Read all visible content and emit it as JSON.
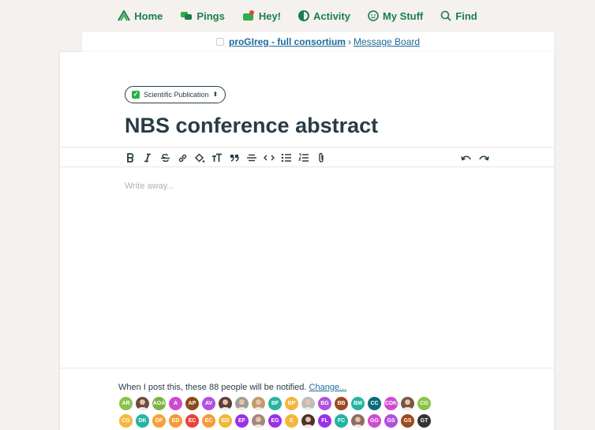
{
  "nav": {
    "home": "Home",
    "pings": "Pings",
    "hey": "Hey!",
    "activity": "Activity",
    "mystuff": "My Stuff",
    "find": "Find"
  },
  "breadcrumb": {
    "project": "proGIreg - full consortium",
    "separator": "›",
    "board": "Message Board"
  },
  "message": {
    "category": "Scientific Publication",
    "title": "NBS conference abstract",
    "placeholder": "Write away..."
  },
  "notify": {
    "text": "When I post this, these 88 people will be notified.",
    "change": "Change..."
  },
  "avatars": {
    "row1": [
      {
        "initials": "AR",
        "color": "#8bc34a"
      },
      {
        "initials": "",
        "color": "#6d4c41",
        "photo": true
      },
      {
        "initials": "AOA",
        "color": "#7cb342"
      },
      {
        "initials": "A",
        "color": "#d04ad0"
      },
      {
        "initials": "AP",
        "color": "#8d4a1d"
      },
      {
        "initials": "AV",
        "color": "#b150e0"
      },
      {
        "initials": "",
        "color": "#5d4037",
        "photo": true
      },
      {
        "initials": "",
        "color": "#9e9e9e",
        "photo": true
      },
      {
        "initials": "",
        "color": "#c49a6c",
        "photo": true
      },
      {
        "initials": "BF",
        "color": "#26b3a2"
      },
      {
        "initials": "BP",
        "color": "#f5b63a"
      },
      {
        "initials": "",
        "color": "#bdbdbd",
        "photo": true
      },
      {
        "initials": "BG",
        "color": "#b150e0"
      },
      {
        "initials": "BB",
        "color": "#9c4a1e"
      },
      {
        "initials": "BM",
        "color": "#26b3a2"
      },
      {
        "initials": "CC",
        "color": "#0a6b78"
      },
      {
        "initials": "CDK",
        "color": "#d04ad0"
      },
      {
        "initials": "",
        "color": "#795548",
        "photo": true
      },
      {
        "initials": "CG",
        "color": "#8bc34a"
      }
    ],
    "row2": [
      {
        "initials": "CG",
        "color": "#f5b63a"
      },
      {
        "initials": "DK",
        "color": "#26b3a2"
      },
      {
        "initials": "DF",
        "color": "#f5a03a"
      },
      {
        "initials": "ED",
        "color": "#f59a3a"
      },
      {
        "initials": "EC",
        "color": "#e8433a"
      },
      {
        "initials": "EC",
        "color": "#f59a3a"
      },
      {
        "initials": "ED",
        "color": "#f5b63a"
      },
      {
        "initials": "EF",
        "color": "#9b30e8"
      },
      {
        "initials": "",
        "color": "#a1887f",
        "photo": true
      },
      {
        "initials": "EG",
        "color": "#9b30e8"
      },
      {
        "initials": "E",
        "color": "#f5b63a"
      },
      {
        "initials": "",
        "color": "#4e342e",
        "photo": true
      },
      {
        "initials": "FL",
        "color": "#9b30e8"
      },
      {
        "initials": "FC",
        "color": "#26b3a2"
      },
      {
        "initials": "",
        "color": "#8d6e63",
        "photo": true
      },
      {
        "initials": "GG",
        "color": "#d04ad0"
      },
      {
        "initials": "GS",
        "color": "#b150e0"
      },
      {
        "initials": "GS",
        "color": "#9c4a1e"
      },
      {
        "initials": "GT",
        "color": "#333333"
      }
    ]
  }
}
